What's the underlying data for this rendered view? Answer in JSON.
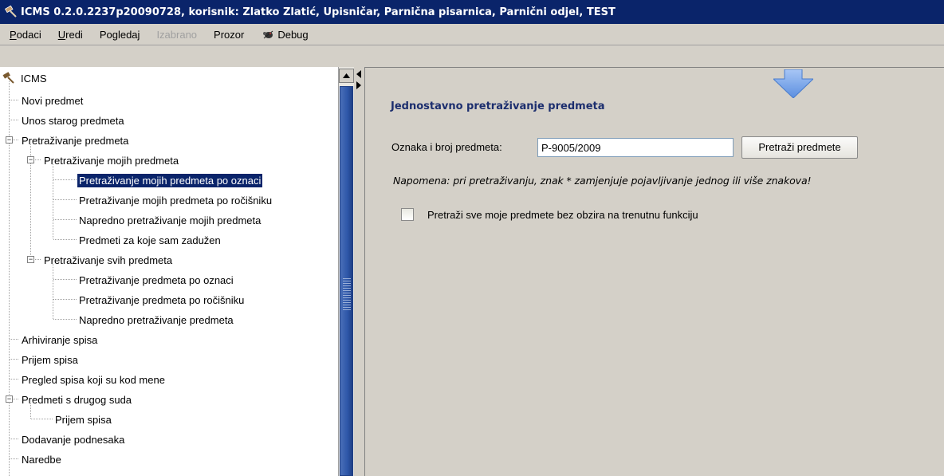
{
  "window": {
    "title": "ICMS 0.2.0.2237p20090728, korisnik: Zlatko Zlatić, Upisničar, Parnična pisarnica, Parnični odjel, TEST",
    "icon": "gavel-icon"
  },
  "menu": {
    "items": [
      {
        "label": "Podaci",
        "underline": "P",
        "rest": "odaci",
        "enabled": true
      },
      {
        "label": "Uredi",
        "underline": "U",
        "rest": "redi",
        "enabled": true
      },
      {
        "label": "Pogledaj",
        "underline": "",
        "rest": "Pogledaj",
        "enabled": true
      },
      {
        "label": "Izabrano",
        "underline": "",
        "rest": "Izabrano",
        "enabled": false
      },
      {
        "label": "Prozor",
        "underline": "",
        "rest": "Prozor",
        "enabled": true
      }
    ],
    "debug_label": "Debug",
    "debug_icon": "bug-icon"
  },
  "tree": {
    "root": "ICMS",
    "items": [
      {
        "label": "Novi predmet",
        "level": 1
      },
      {
        "label": "Unos starog predmeta",
        "level": 1
      },
      {
        "label": "Pretraživanje predmeta",
        "level": 1,
        "expanded": true
      },
      {
        "label": "Pretraživanje mojih predmeta",
        "level": 2,
        "expanded": true
      },
      {
        "label": "Pretraživanje mojih predmeta po oznaci",
        "level": 3,
        "selected": true
      },
      {
        "label": "Pretraživanje mojih predmeta po ročišniku",
        "level": 3
      },
      {
        "label": "Napredno pretraživanje mojih predmeta",
        "level": 3
      },
      {
        "label": "Predmeti za koje sam zadužen",
        "level": 3
      },
      {
        "label": "Pretraživanje svih predmeta",
        "level": 2,
        "expanded": true
      },
      {
        "label": "Pretraživanje predmeta po oznaci",
        "level": 3
      },
      {
        "label": "Pretraživanje predmeta po ročišniku",
        "level": 3
      },
      {
        "label": "Napredno pretraživanje predmeta",
        "level": 3
      },
      {
        "label": "Arhiviranje spisa",
        "level": 1
      },
      {
        "label": "Prijem spisa",
        "level": 1
      },
      {
        "label": "Pregled spisa koji su kod mene",
        "level": 1
      },
      {
        "label": "Predmeti s drugog suda",
        "level": 1,
        "expanded": true
      },
      {
        "label": "Prijem spisa",
        "level": 2
      },
      {
        "label": "Dodavanje podnesaka",
        "level": 1
      },
      {
        "label": "Naredbe",
        "level": 1
      }
    ]
  },
  "search": {
    "section_title": "Jednostavno pretraživanje predmeta",
    "field_label": "Oznaka i broj predmeta:",
    "field_value": "P-9005/2009",
    "button_label": "Pretraži predmete",
    "note": "Napomena: pri pretraživanju, znak * zamjenjuje pojavljivanje jednog ili više znakova!",
    "checkbox_label": "Pretraži sve moje predmete bez obzira na trenutnu funkciju",
    "checkbox_checked": false
  },
  "colors": {
    "titlebar": "#0a246a",
    "selection": "#0a246a",
    "section_title": "#1c2e6e",
    "scroll_thumb": "#2d56a8",
    "arrow": "#6d9ee8"
  }
}
